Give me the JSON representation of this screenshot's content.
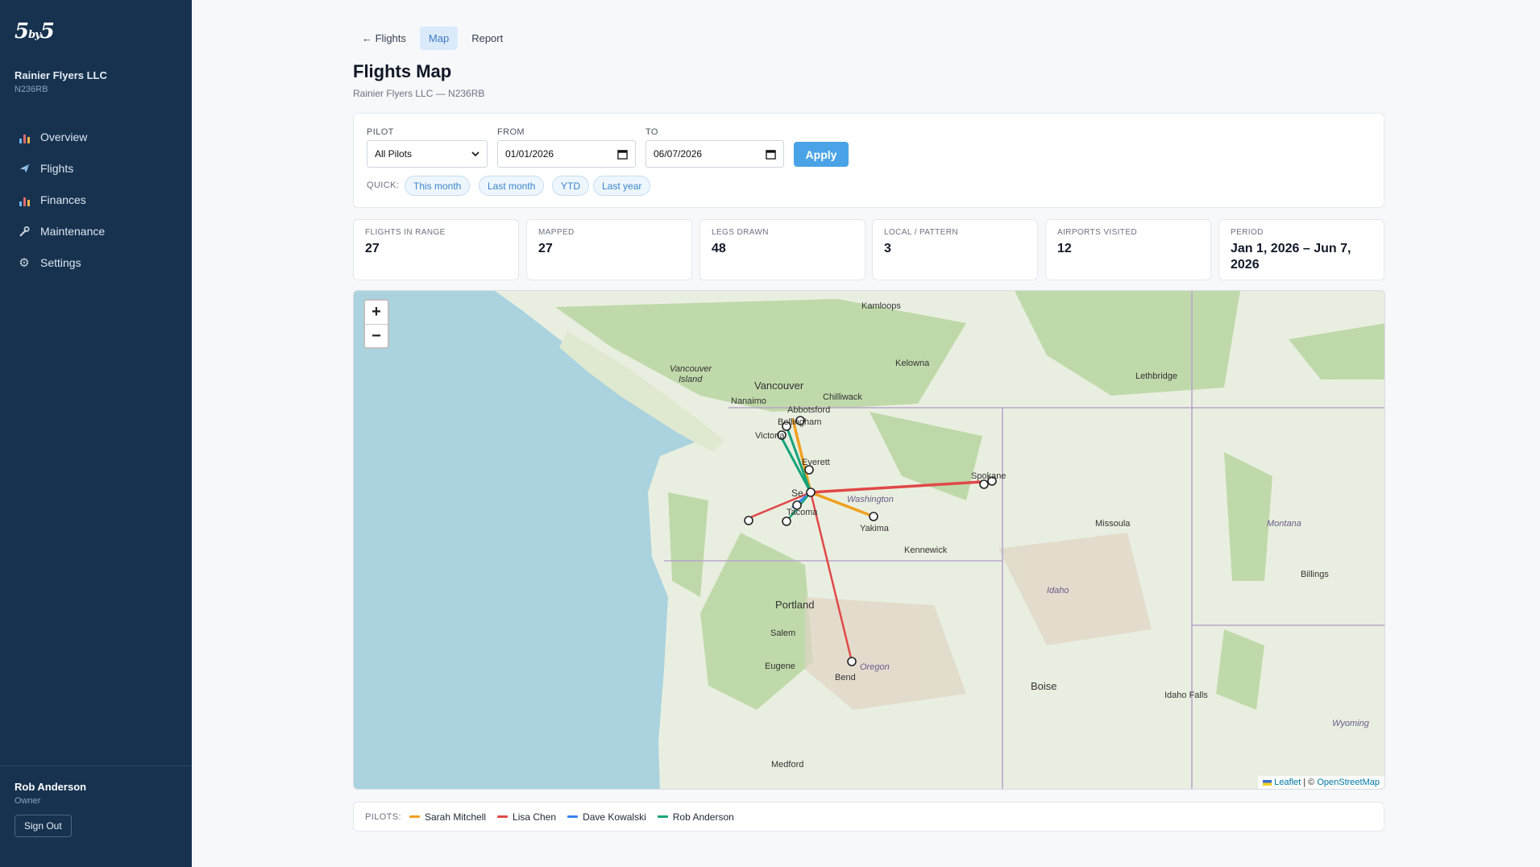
{
  "sidebar": {
    "logo_main": "5",
    "logo_small": "by",
    "logo_tail": "5",
    "org_name": "Rainier Flyers LLC",
    "tail_number": "N236RB",
    "items": [
      {
        "label": "Overview",
        "icon": "chart-icon"
      },
      {
        "label": "Flights",
        "icon": "plane-icon"
      },
      {
        "label": "Finances",
        "icon": "chart-icon"
      },
      {
        "label": "Maintenance",
        "icon": "wrench-icon"
      },
      {
        "label": "Settings",
        "icon": "gear-icon"
      }
    ],
    "user_name": "Rob Anderson",
    "user_role": "Owner",
    "signout_label": "Sign Out"
  },
  "tabs": {
    "back_label": "← Flights",
    "map_label": "Map",
    "report_label": "Report"
  },
  "header": {
    "title": "Flights Map",
    "subtitle": "Rainier Flyers LLC — N236RB"
  },
  "filters": {
    "pilot_label": "PILOT",
    "pilot_value": "All Pilots",
    "from_label": "FROM",
    "from_value": "01/01/2026",
    "to_label": "TO",
    "to_value": "06/07/2026",
    "apply_label": "Apply",
    "quick_label": "QUICK:",
    "quick": [
      "This month",
      "Last month",
      "YTD",
      "Last year"
    ]
  },
  "stats": [
    {
      "label": "FLIGHTS IN RANGE",
      "value": "27"
    },
    {
      "label": "MAPPED",
      "value": "27"
    },
    {
      "label": "LEGS DRAWN",
      "value": "48"
    },
    {
      "label": "LOCAL / PATTERN",
      "value": "3"
    },
    {
      "label": "AIRPORTS VISITED",
      "value": "12"
    },
    {
      "label": "PERIOD",
      "value": "Jan 1, 2026 – Jun 7, 2026"
    }
  ],
  "map": {
    "zoom_in": "+",
    "zoom_out": "−",
    "attribution_leaflet": "Leaflet",
    "attribution_sep": " | © ",
    "attribution_osm": "OpenStreetMap",
    "labels": {
      "kamloops": "Kamloops",
      "kelowna": "Kelowna",
      "lethbridge": "Lethbridge",
      "vancouver_island_1": "Vancouver",
      "vancouver_island_2": "Island",
      "vancouver": "Vancouver",
      "nanaimo": "Nanaimo",
      "chilliwack": "Chilliwack",
      "abbotsford": "Abbotsford",
      "bellingham": "Bellingham",
      "victoria": "Victoria",
      "everett": "Everett",
      "seattle": "Se",
      "tacoma": "Tacoma",
      "washington": "Washington",
      "yakima": "Yakima",
      "spokane": "Spokane",
      "kennewick": "Kennewick",
      "missoula": "Missoula",
      "montana": "Montana",
      "billings": "Billings",
      "idaho": "Idaho",
      "portland": "Portland",
      "salem": "Salem",
      "eugene": "Eugene",
      "bend": "Bend",
      "oregon": "Oregon",
      "boise": "Boise",
      "idaho_falls": "Idaho Falls",
      "wyoming": "Wyoming",
      "medford": "Medford"
    }
  },
  "legend": {
    "title": "PILOTS:",
    "pilots": [
      {
        "name": "Sarah Mitchell",
        "color": "#f0a020"
      },
      {
        "name": "Lisa Chen",
        "color": "#e04848"
      },
      {
        "name": "Dave Kowalski",
        "color": "#3b82f6"
      },
      {
        "name": "Rob Anderson",
        "color": "#16a37a"
      }
    ]
  }
}
